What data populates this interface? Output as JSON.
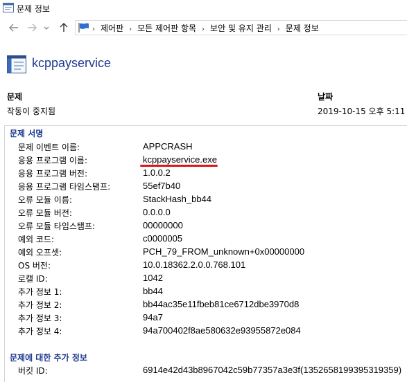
{
  "window": {
    "title": "문제 정보"
  },
  "address_bar": {
    "crumbs": [
      "제어판",
      "모든 제어판 항목",
      "보안 및 유지 관리",
      "문제 정보"
    ]
  },
  "header": {
    "app_name": "kcppayservice"
  },
  "summary": {
    "problem_label": "문제",
    "problem_value": "작동이 중지됨",
    "date_label": "날짜",
    "date_value": "2019-10-15 오후 5:11"
  },
  "signature": {
    "title": "문제 서명",
    "rows": [
      {
        "key": "문제 이벤트 이름:",
        "value": "APPCRASH"
      },
      {
        "key": "응용 프로그램 이름:",
        "value": "kcppayservice.exe"
      },
      {
        "key": "응용 프로그램 버전:",
        "value": "1.0.0.2"
      },
      {
        "key": "응용 프로그램 타임스탬프:",
        "value": "55ef7b40"
      },
      {
        "key": "오류 모듈 이름:",
        "value": "StackHash_bb44"
      },
      {
        "key": "오류 모듈 버전:",
        "value": "0.0.0.0"
      },
      {
        "key": "오류 모듈 타임스탬프:",
        "value": "00000000"
      },
      {
        "key": "예외 코드:",
        "value": "c0000005"
      },
      {
        "key": "예외 오프셋:",
        "value": "PCH_79_FROM_unknown+0x00000000"
      },
      {
        "key": "OS 버전:",
        "value": "10.0.18362.2.0.0.768.101"
      },
      {
        "key": "로캘 ID:",
        "value": "1042"
      },
      {
        "key": "추가 정보 1:",
        "value": "bb44"
      },
      {
        "key": "추가 정보 2:",
        "value": "bb44ac35e11fbeb81ce6712dbe3970d8"
      },
      {
        "key": "추가 정보 3:",
        "value": "94a7"
      },
      {
        "key": "추가 정보 4:",
        "value": "94a700402f8ae580632e93955872e084"
      }
    ]
  },
  "extra_info": {
    "title": "문제에 대한 추가 정보",
    "rows": [
      {
        "key": "버킷 ID:",
        "value": "6914e42d43b8967042c59b77357a3e3f(1352658199395319359)"
      }
    ]
  },
  "colors": {
    "accent": "#1e3b8f",
    "highlight": "#e0131b"
  },
  "icons": [
    "app-window-icon",
    "back-arrow-icon",
    "forward-arrow-icon",
    "chevron-down-icon",
    "up-arrow-icon",
    "control-panel-flag-icon",
    "application-icon"
  ]
}
